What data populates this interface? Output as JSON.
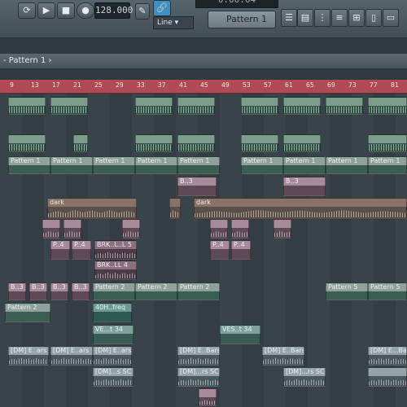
{
  "toolbar": {
    "tempo": "128.000",
    "time": "0:00:04",
    "pattern": "Pattern 1",
    "snap": "Line",
    "play_icon": "play-icon",
    "stop_icon": "stop-icon",
    "record_icon": "record-icon",
    "loop_icon": "loop-icon"
  },
  "playlist": {
    "title": "- Pattern 1 ›"
  },
  "ruler": [
    "9",
    "13",
    "17",
    "21",
    "25",
    "29",
    "33",
    "37",
    "41",
    "45",
    "49",
    "53",
    "57",
    "61",
    "65",
    "69",
    "73",
    "77",
    "81"
  ],
  "clips": {
    "pattern1": "Pattern 1",
    "pattern2": "Pattern 2",
    "pattern5": "Pattern 5",
    "dark": "dark",
    "b3": "B..3",
    "p4": "P..4",
    "brk1": "BRK..L..L 5",
    "brk2": "BRK..LL 4",
    "freq": "40H..freq",
    "ves1": "VE...t 34",
    "ves2": "VES..t 34",
    "dm_bars": "[DM] E..ars",
    "dm_bars2": "[DM] E..Bars",
    "dm_bars3": "[DM] E...Bars",
    "dm_sc": "[DM]...s SC",
    "dm_rs": "[DM]...rs SC"
  },
  "colors": {
    "ruler": "#b04a54",
    "toolbar": "#4c5960",
    "grid": "#39444a"
  }
}
